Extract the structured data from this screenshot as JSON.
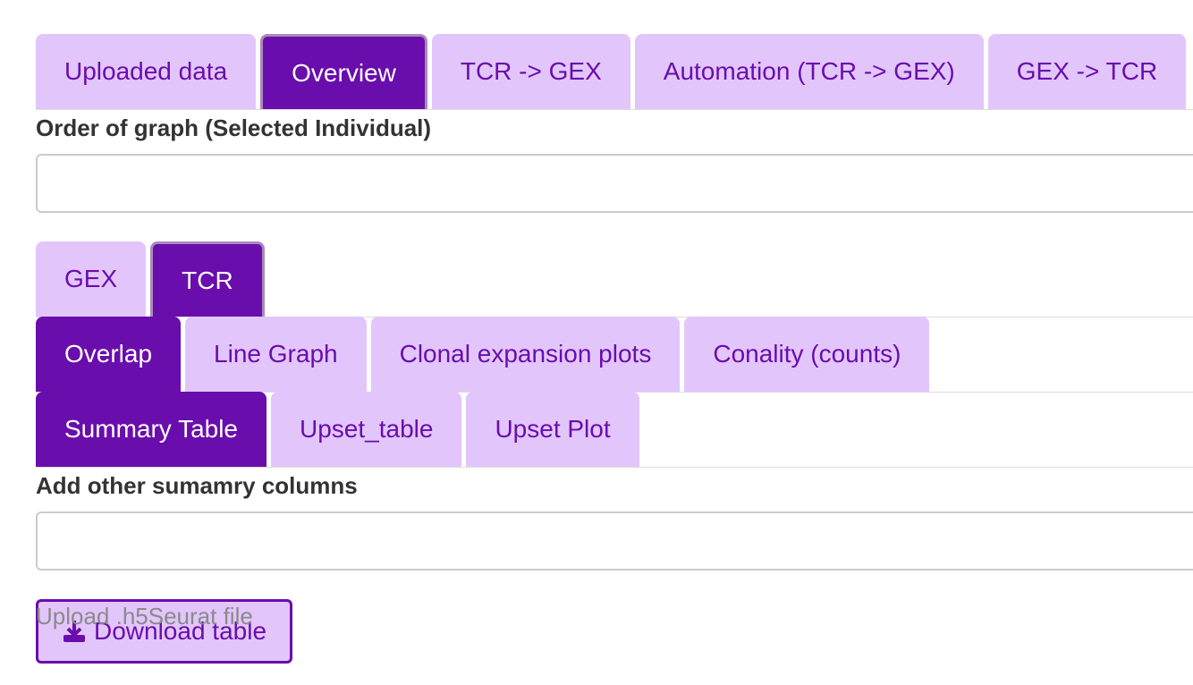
{
  "top_tabs": [
    {
      "label": "Uploaded data",
      "active": false
    },
    {
      "label": "Overview",
      "active": true
    },
    {
      "label": "TCR -> GEX",
      "active": false
    },
    {
      "label": "Automation (TCR -> GEX)",
      "active": false
    },
    {
      "label": "GEX -> TCR",
      "active": false
    }
  ],
  "order_graph": {
    "label": "Order of graph (Selected Individual)",
    "value": ""
  },
  "data_tabs": [
    {
      "label": "GEX",
      "active": false
    },
    {
      "label": "TCR",
      "active": true
    }
  ],
  "plot_tabs": [
    {
      "label": "Overlap",
      "active": true
    },
    {
      "label": "Line Graph",
      "active": false
    },
    {
      "label": "Clonal expansion plots",
      "active": false
    },
    {
      "label": "Conality (counts)",
      "active": false
    }
  ],
  "table_tabs": [
    {
      "label": "Summary Table",
      "active": true
    },
    {
      "label": "Upset_table",
      "active": false
    },
    {
      "label": "Upset Plot",
      "active": false
    }
  ],
  "summary_columns": {
    "label": "Add other sumamry columns",
    "value": ""
  },
  "download": {
    "label": "Download table",
    "icon": "download-icon"
  },
  "upload_overlay": "Upload .h5Seurat file",
  "colors": {
    "accent": "#6a0dad",
    "tab_bg": "#e2c6fb"
  }
}
